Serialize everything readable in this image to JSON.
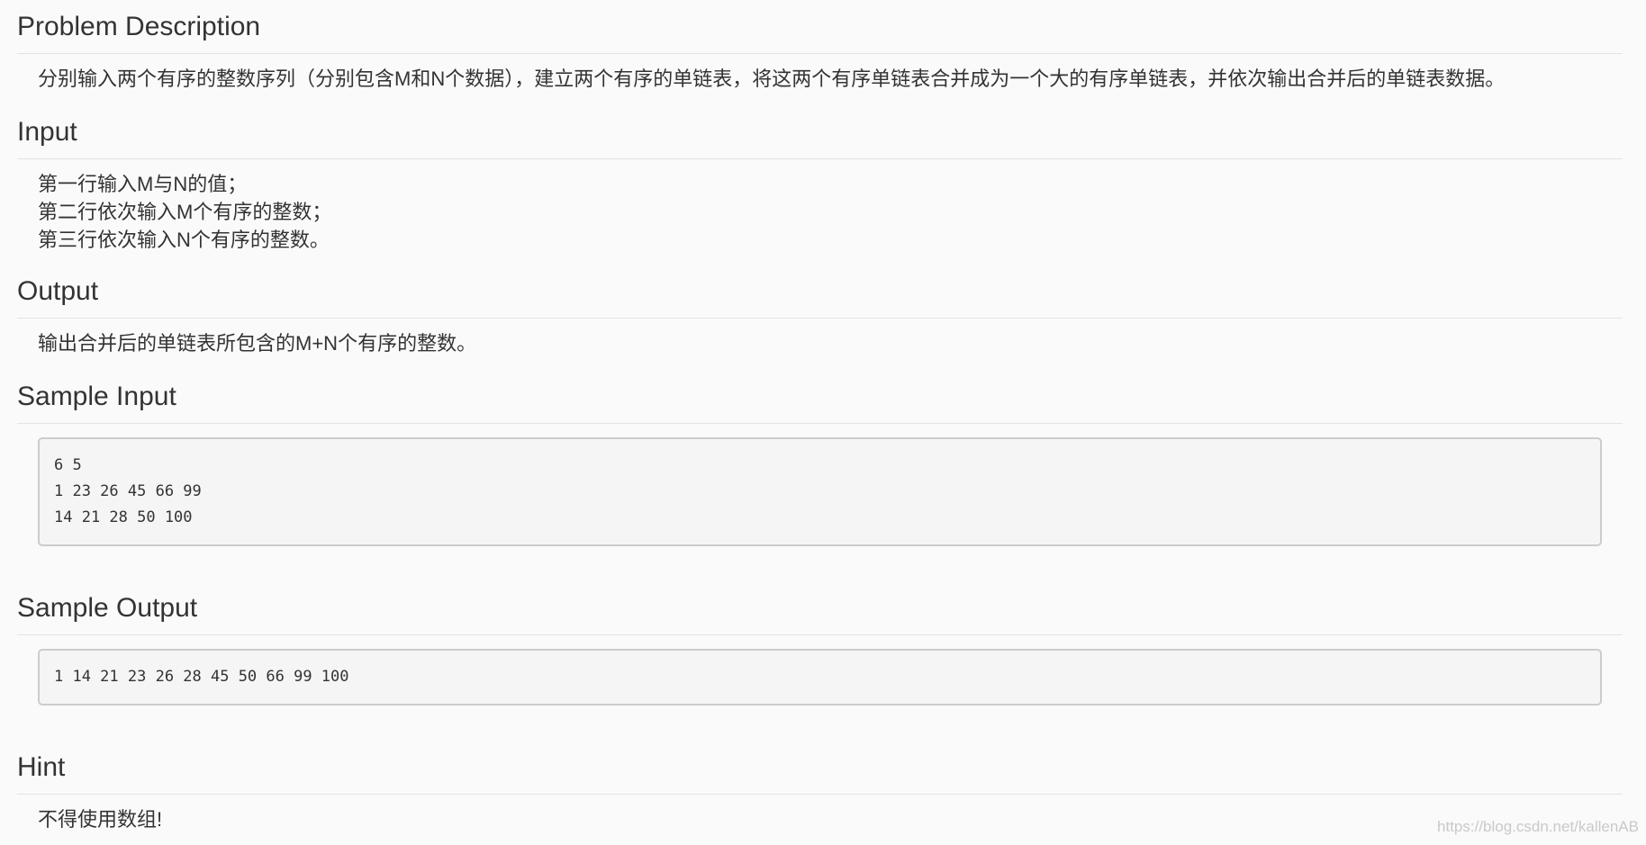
{
  "sections": {
    "description": {
      "title": "Problem Description",
      "text": "分别输入两个有序的整数序列（分别包含M和N个数据），建立两个有序的单链表，将这两个有序单链表合并成为一个大的有序单链表，并依次输出合并后的单链表数据。"
    },
    "input": {
      "title": "Input",
      "lines": [
        "第一行输入M与N的值；",
        "第二行依次输入M个有序的整数；",
        "第三行依次输入N个有序的整数。"
      ]
    },
    "output": {
      "title": "Output",
      "text": "输出合并后的单链表所包含的M+N个有序的整数。"
    },
    "sample_input": {
      "title": "Sample Input",
      "lines": [
        "6 5",
        "1 23 26 45 66 99",
        "14 21 28 50 100"
      ]
    },
    "sample_output": {
      "title": "Sample Output",
      "lines": [
        "1 14 21 23 26 28 45 50 66 99 100"
      ]
    },
    "hint": {
      "title": "Hint",
      "text": "不得使用数组!"
    }
  },
  "watermark": "https://blog.csdn.net/kallenAB",
  "colors": {
    "background": "#fafafa",
    "text": "#333333",
    "divider": "#e3e3e3",
    "code_background": "#f5f5f5",
    "code_border": "#cccccc",
    "watermark": "#c9c9c9"
  }
}
